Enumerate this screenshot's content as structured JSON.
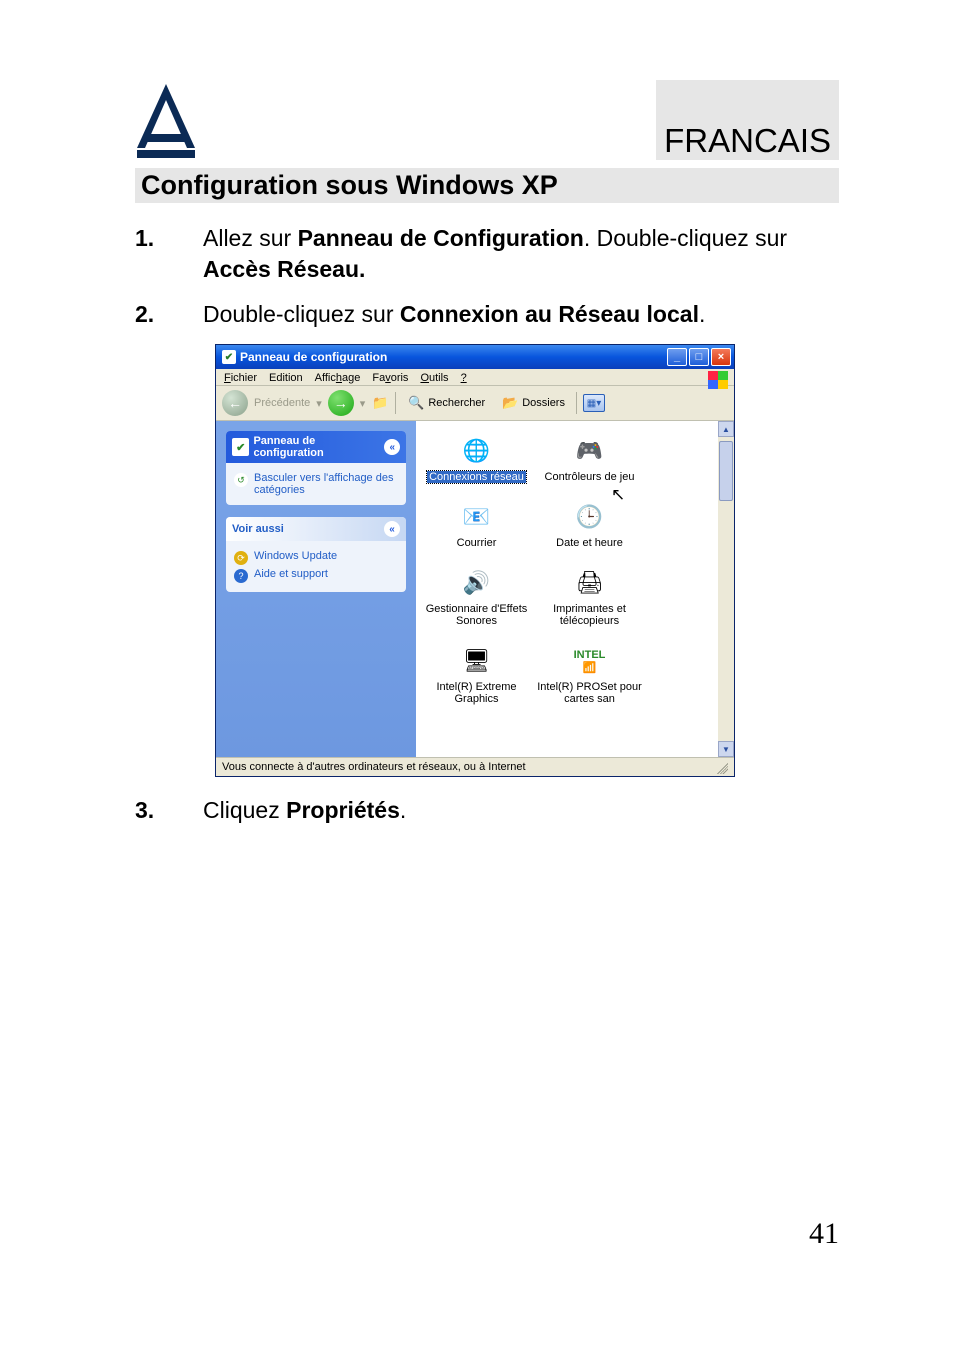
{
  "header": {
    "language": "FRANCAIS",
    "title": "Configuration sous   Windows XP"
  },
  "steps": {
    "s1_num": "1.",
    "s1_a": "Allez  sur ",
    "s1_b": "Panneau de Configuration",
    "s1_c": ". Double-cliquez sur ",
    "s1_d": "Accès Réseau.",
    "s2_num": "2.",
    "s2_a": "Double-cliquez sur ",
    "s2_b": "Connexion au Réseau local",
    "s2_c": ".",
    "s3_num": "3.",
    "s3_a": "Cliquez ",
    "s3_b": "Propriétés",
    "s3_c": "."
  },
  "window": {
    "title": "Panneau de configuration",
    "menus": {
      "file": "Fichier",
      "edit": "Edition",
      "view": "Affichage",
      "fav": "Favoris",
      "tools": "Outils",
      "help": "?"
    },
    "toolbar": {
      "back": "Précédente",
      "search": "Rechercher",
      "folders": "Dossiers"
    },
    "sidebar": {
      "panel1_title": "Panneau de configuration",
      "panel1_link": "Basculer vers l'affichage des catégories",
      "panel2_title": "Voir aussi",
      "panel2_link1": "Windows Update",
      "panel2_link2": "Aide et support"
    },
    "items": {
      "i0": "Connexions réseau",
      "i1": "Contrôleurs de jeu",
      "i2": "Courrier",
      "i3": "Date et heure",
      "i4": "Gestionnaire d'Effets Sonores",
      "i5": "Imprimantes et télécopieurs",
      "i6": "Intel(R) Extreme Graphics",
      "i7": "Intel(R) PROSet pour cartes san"
    },
    "status": "Vous connecte à d'autres ordinateurs et réseaux, ou à Internet"
  },
  "page_number": "41"
}
